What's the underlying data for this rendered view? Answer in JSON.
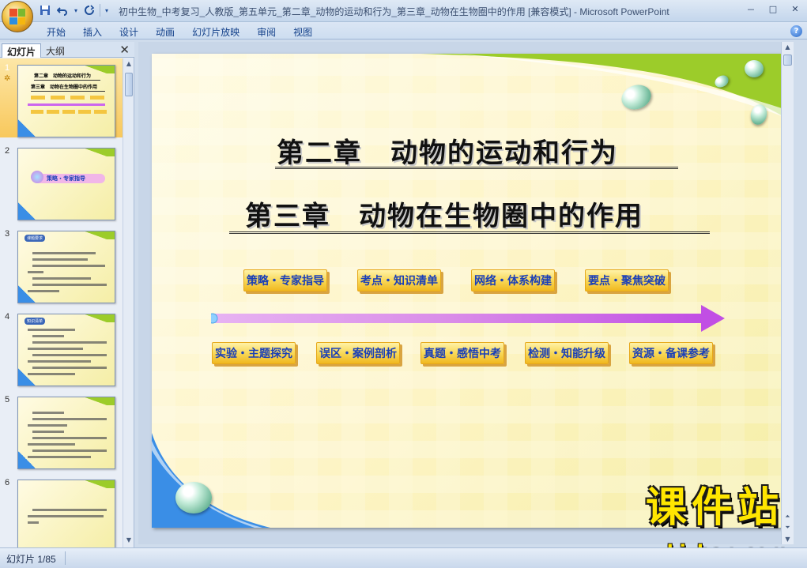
{
  "window": {
    "title": "初中生物_中考复习_人教版_第五单元_第二章_动物的运动和行为_第三章_动物在生物圈中的作用 [兼容模式] - Microsoft PowerPoint",
    "controls": [
      "－",
      "□",
      "✕"
    ]
  },
  "quick_access": [
    "save-icon",
    "undo-icon",
    "redo-icon"
  ],
  "ribbon": {
    "tabs": [
      "开始",
      "插入",
      "设计",
      "动画",
      "幻灯片放映",
      "审阅",
      "视图"
    ],
    "help": "?"
  },
  "left_panel": {
    "tab_slides": "幻灯片",
    "tab_outline": "大纲",
    "close": "✕",
    "thumbnails": [
      {
        "num": "1",
        "title1": "第二章　动物的运动和行为",
        "title2": "第三章　动物在生物圈中的作用",
        "selected": true
      },
      {
        "num": "2",
        "label": "策略・专家指导"
      },
      {
        "num": "3",
        "label": "课题要求"
      },
      {
        "num": "4",
        "label": "知识清单"
      },
      {
        "num": "5"
      },
      {
        "num": "6"
      }
    ]
  },
  "slide": {
    "heading1": "第二章　动物的运动和行为",
    "heading2": "第三章　动物在生物圈中的作用",
    "row1_buttons": [
      "策略・专家指导",
      "考点・知识清单",
      "网络・体系构建",
      "要点・聚焦突破"
    ],
    "row2_buttons": [
      "实验・主题探究",
      "误区・案例剖析",
      "真题・感悟中考",
      "检测・知能升级",
      "资源・备课参考"
    ]
  },
  "watermark": {
    "text": "课件站",
    "url": "www.kjzhan.com"
  },
  "status": {
    "slide_counter": "幻灯片 1/85"
  },
  "colors": {
    "button_text": "#1a3fb8",
    "button_fill": "#f8d858",
    "arrow": "#cc66ee",
    "watermark": "#ffe600",
    "selected_thumb": "#f8c85c"
  }
}
